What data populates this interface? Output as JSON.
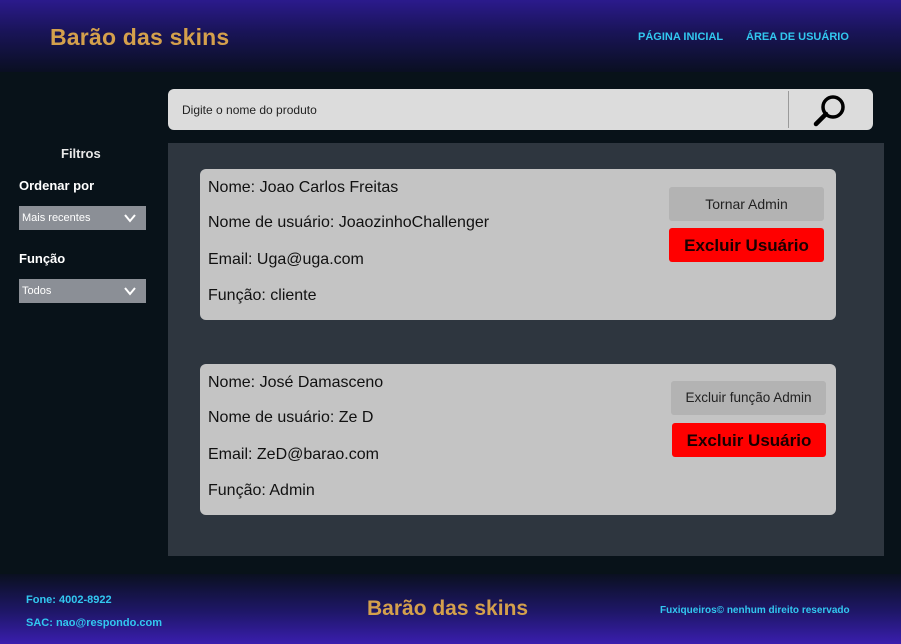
{
  "header": {
    "brand": "Barão das skins",
    "nav": {
      "home": "PÁGINA INICIAL",
      "user_area": "ÁREA DE USUÁRIO"
    }
  },
  "search": {
    "placeholder": "Digite o nome do produto",
    "icon": "search-icon"
  },
  "sidebar": {
    "title": "Filtros",
    "sort": {
      "label": "Ordenar por",
      "selected": "Mais recentes"
    },
    "role": {
      "label": "Função",
      "selected": "Todos"
    }
  },
  "users": [
    {
      "name": "Nome: Joao Carlos Freitas",
      "username": "Nome de usuário: JoaozinhoChallenger",
      "email": "Email: Uga@uga.com",
      "role": "Função: cliente",
      "role_button": "Tornar Admin",
      "delete_button": "Excluir Usuário"
    },
    {
      "name": "Nome: José Damasceno",
      "username": "Nome de usuário: Ze D",
      "email": "Email: ZeD@barao.com",
      "role": "Função: Admin",
      "role_button": "Excluir função Admin",
      "delete_button": "Excluir Usuário"
    }
  ],
  "footer": {
    "phone": "Fone: 4002-8922",
    "sac": "SAC: nao@respondo.com",
    "brand": "Barão das skins",
    "rights": "Fuxiqueiros© nenhum direito reservado"
  },
  "colors": {
    "brand_gold": "#d4a04c",
    "link_cyan": "#32c8f0",
    "danger_red": "#ff0000",
    "card_grey": "#c4c4c4"
  }
}
